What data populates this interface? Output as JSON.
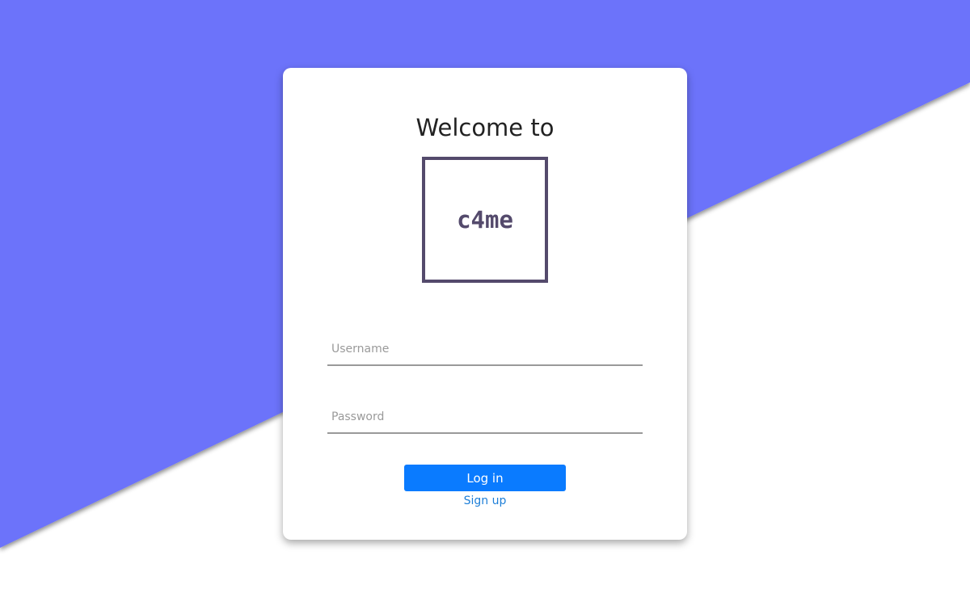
{
  "colors": {
    "background_band": "#6c73fa",
    "page_background": "#ffffff",
    "card": "#ffffff",
    "logo": "#544a6c",
    "primary_button": "#0a7bff",
    "link": "#1e7fd8"
  },
  "login": {
    "welcome_text": "Welcome to",
    "logo_text": "c4me",
    "username_placeholder": "Username",
    "password_placeholder": "Password",
    "login_label": "Log in",
    "signup_label": "Sign up"
  }
}
